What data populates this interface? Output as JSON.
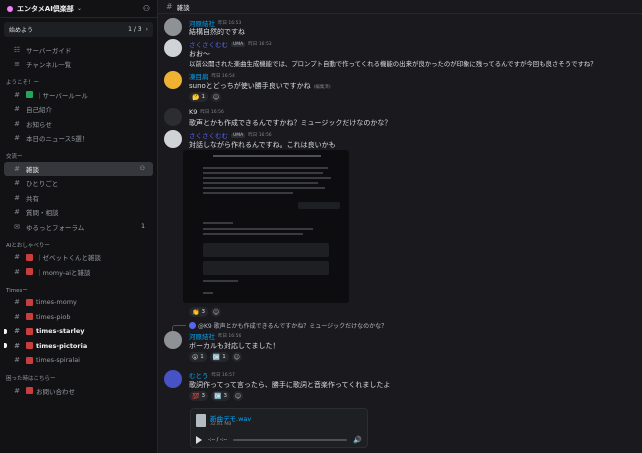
{
  "server": {
    "name": "エンタメAI倶楽部",
    "onboarding_label": "始めよう",
    "onboarding_progress": "1 / 3"
  },
  "sidebar": {
    "top_items": [
      {
        "label": "サーバーガイド"
      },
      {
        "label": "チャンネル一覧"
      }
    ],
    "categories": [
      {
        "label": "ようこそ！ー",
        "items": [
          {
            "label": "｜サーバールール"
          },
          {
            "label": "自己紹介"
          },
          {
            "label": "お知らせ"
          },
          {
            "label": "本日のニュース5選！"
          }
        ]
      },
      {
        "label": "交流ー",
        "items": [
          {
            "label": "雑談"
          },
          {
            "label": "ひとりごと"
          },
          {
            "label": "共有"
          },
          {
            "label": "質問・相談"
          },
          {
            "label": "ゆるっとフォーラム",
            "count": "1"
          }
        ]
      },
      {
        "label": "AIとおしゃべりー",
        "items": [
          {
            "label": "｜ゼベットくんと雑談"
          },
          {
            "label": "｜momy-aiと雑談"
          }
        ]
      },
      {
        "label": "Timesー",
        "items": [
          {
            "label": "times-momy"
          },
          {
            "label": "times-piob"
          },
          {
            "label": "times-starley"
          },
          {
            "label": "times-pictoria"
          },
          {
            "label": "times-spiralai"
          }
        ]
      },
      {
        "label": "困った時はこちらー",
        "items": [
          {
            "label": "お問い合わせ"
          }
        ]
      }
    ]
  },
  "channel": {
    "name": "雑談"
  },
  "messages": [
    {
      "author": "河原結社",
      "time": "昨日 16:53",
      "text": "結構自然的ですね"
    },
    {
      "author": "さくさくむむ",
      "tag": "UMA",
      "time": "昨日 16:53",
      "text": "おお〜",
      "text2": "以前公開された楽曲生成機能では、プロンプト自動で作ってくれる機能の出来が良かったのが印象に残ってるんですが今回も良さそうですね？"
    },
    {
      "author": "凍目肩",
      "time": "昨日 16:54",
      "text": "sunoとどっちが使い勝手良いですかね",
      "edited": "(編集済)",
      "reactions": [
        {
          "emoji": "🤔",
          "count": "1"
        }
      ]
    },
    {
      "author": "K9",
      "time": "昨日 16:56",
      "text": "歌声とかも作成できるんですかね？ミュージックだけなのかな？"
    },
    {
      "author": "さくさくむむ",
      "tag": "UMA",
      "time": "昨日 16:56",
      "text": "対話しながら作れるんですね。これは良いかも",
      "reactions": [
        {
          "emoji": "👏",
          "count": "3"
        }
      ]
    },
    {
      "reply": "@K9 歌声とかも作成できるんですかね？ミュージックだけなのかな？",
      "author": "河原結社",
      "time": "昨日 16:56",
      "text": "ボーカルも対応してました！",
      "reactions": [
        {
          "emoji": "😮",
          "count": "1"
        },
        {
          "emoji": "🆗",
          "count": "1"
        }
      ]
    },
    {
      "author": "むとう",
      "time": "昨日 16:57",
      "text": "歌詞作ってって言ったら、勝手に歌詞と音楽作ってくれましたよ",
      "reactions": [
        {
          "emoji": "💯",
          "count": "3"
        },
        {
          "emoji": "🆗",
          "count": "3"
        }
      ]
    }
  ],
  "attachment": {
    "name": "新曲デモ.wav",
    "size": "32.81 MB",
    "time": "-:-- / -:--"
  },
  "colors": {
    "accent": "#5865f2",
    "link": "#00a8fc"
  }
}
